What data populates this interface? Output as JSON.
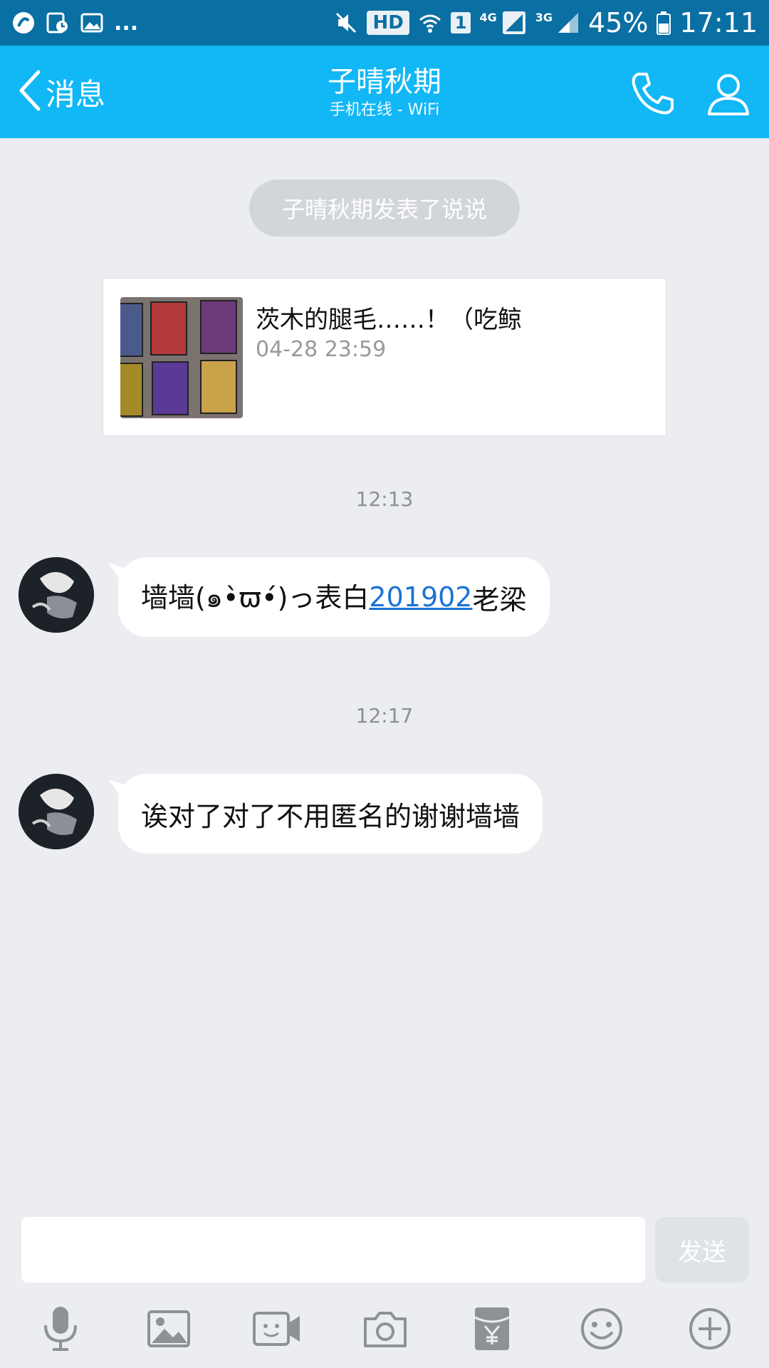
{
  "status_bar": {
    "more_indicator": "...",
    "hd": "HD",
    "sim": "1",
    "net_4g": "4G",
    "net_3g": "3G",
    "battery": "45%",
    "time": "17:11"
  },
  "header": {
    "back_label": "消息",
    "title": "子晴秋期",
    "subtitle": "手机在线 - WiFi"
  },
  "conversation": {
    "notice": "子晴秋期发表了说说",
    "share_card": {
      "title": "茨木的腿毛……！（吃鲸",
      "time": "04-28 23:59"
    },
    "messages": [
      {
        "timestamp": "12:13",
        "text_before": "墙墙(๑•̀ϖ•́)っ表白",
        "link": "201902",
        "text_after": "老梁"
      },
      {
        "timestamp": "12:17",
        "text": "诶对了对了不用匿名的谢谢墙墙"
      }
    ]
  },
  "composer": {
    "input_value": "",
    "send_label": "发送"
  },
  "icons": {
    "back": "chevron-left-icon",
    "phone": "phone-icon",
    "profile": "person-icon",
    "toolbar": [
      "microphone-icon",
      "image-icon",
      "video-call-icon",
      "camera-icon",
      "red-packet-icon",
      "emoji-icon",
      "plus-icon"
    ]
  },
  "colors": {
    "status_bar": "#0a6fa3",
    "header": "#12b7f5",
    "background": "#ebedf0",
    "link": "#1a73d6"
  }
}
